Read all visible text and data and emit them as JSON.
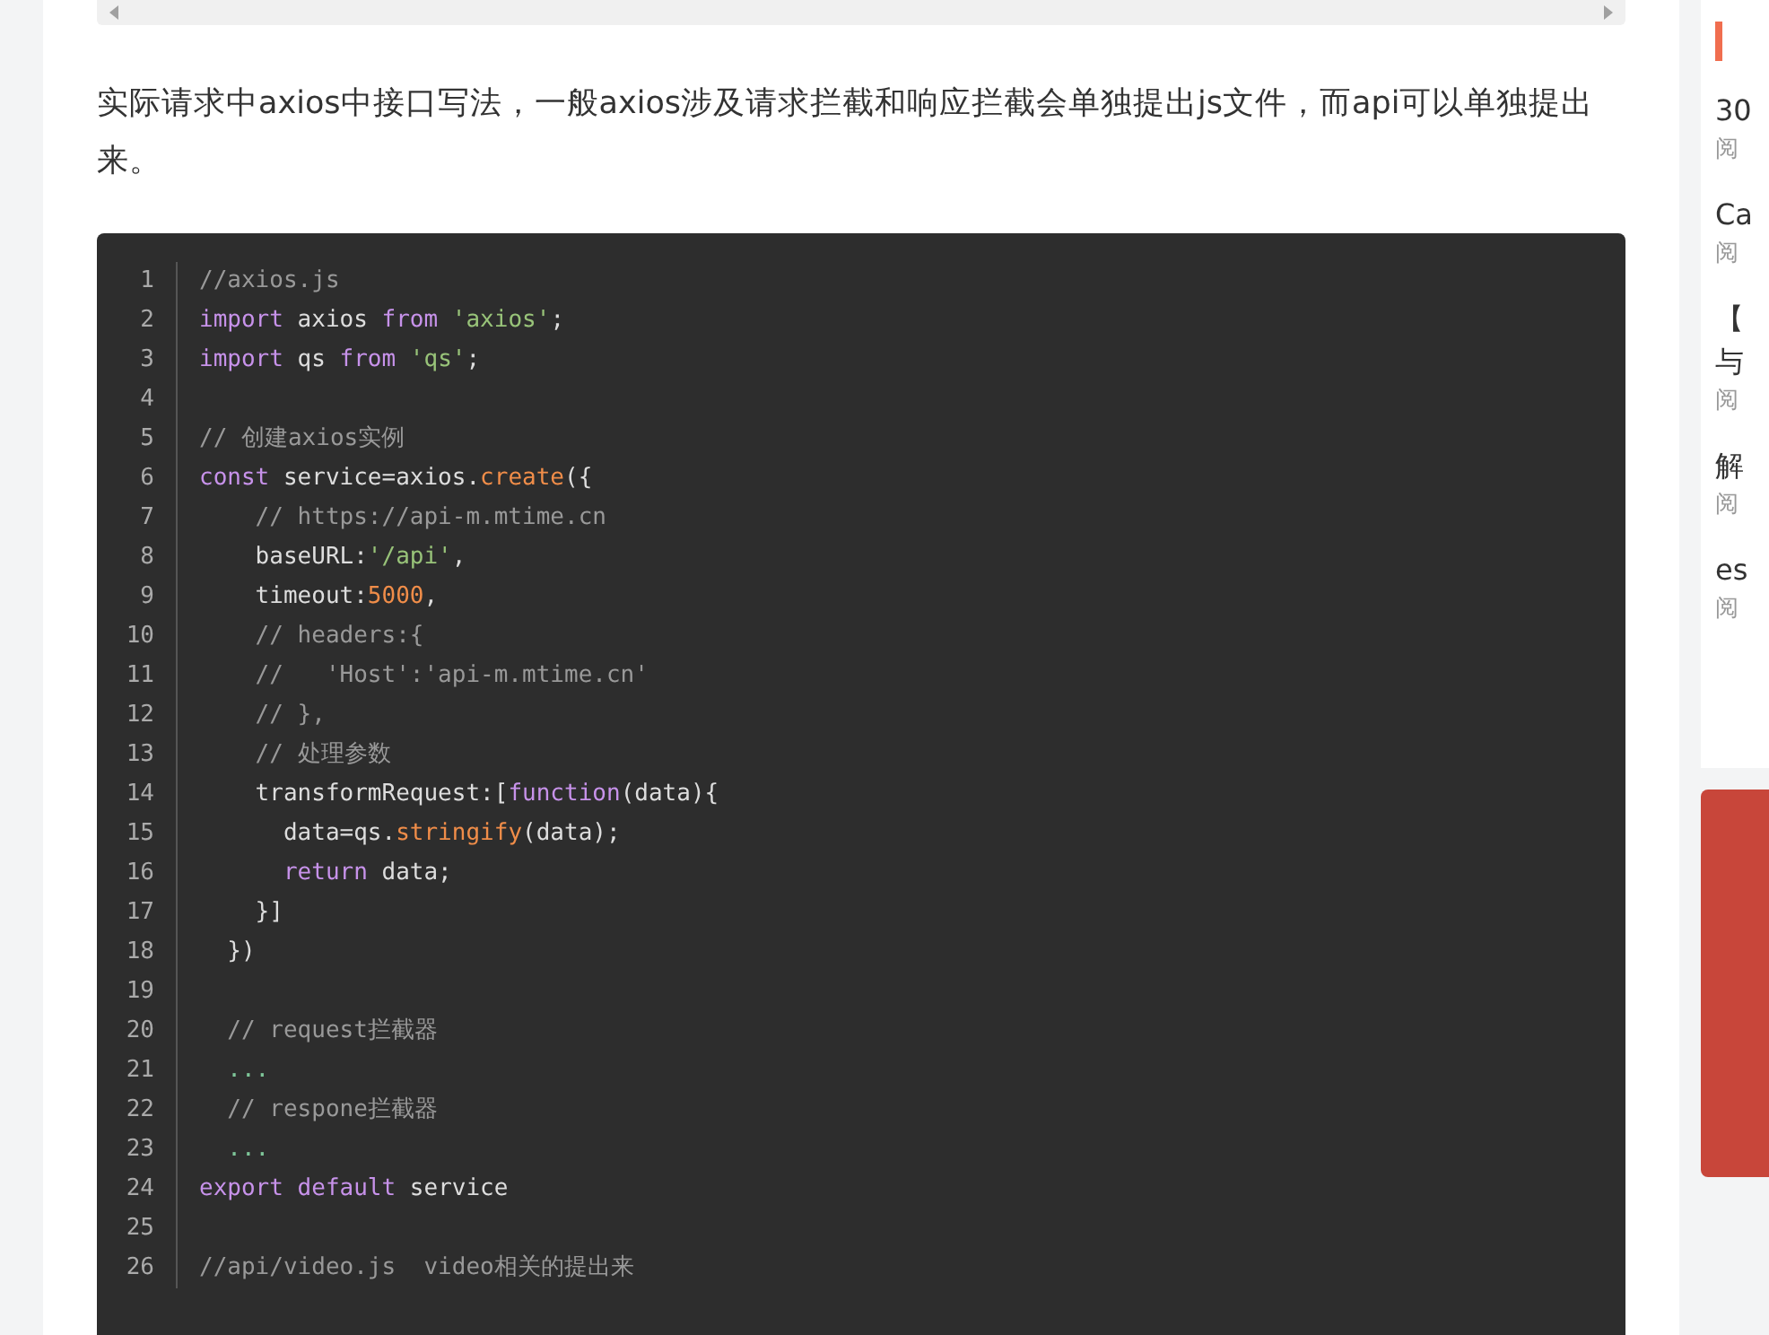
{
  "article": {
    "paragraph": "实际请求中axios中接口写法，一般axios涉及请求拦截和响应拦截会单独提出js文件，而api可以单独提出来。",
    "code_block": {
      "lines": [
        {
          "number": "1",
          "tokens": [
            {
              "kind": "comment",
              "text": "//axios.js"
            }
          ]
        },
        {
          "number": "2",
          "tokens": [
            {
              "kind": "keyword",
              "text": "import"
            },
            {
              "kind": "plain",
              "text": " axios "
            },
            {
              "kind": "keyword",
              "text": "from"
            },
            {
              "kind": "string",
              "text": " 'axios'"
            },
            {
              "kind": "plain",
              "text": ";"
            }
          ]
        },
        {
          "number": "3",
          "tokens": [
            {
              "kind": "keyword",
              "text": "import"
            },
            {
              "kind": "plain",
              "text": " qs "
            },
            {
              "kind": "keyword",
              "text": "from"
            },
            {
              "kind": "string",
              "text": " 'qs'"
            },
            {
              "kind": "plain",
              "text": ";"
            }
          ]
        },
        {
          "number": "4"
        },
        {
          "number": "5",
          "tokens": [
            {
              "kind": "comment",
              "text": "// 创建axios实例"
            }
          ]
        },
        {
          "number": "6",
          "tokens": [
            {
              "kind": "keyword",
              "text": "const"
            },
            {
              "kind": "plain",
              "text": " service=axios."
            },
            {
              "kind": "func",
              "text": "create"
            },
            {
              "kind": "plain",
              "text": "({"
            }
          ]
        },
        {
          "number": "7",
          "tokens": [
            {
              "kind": "comment",
              "text": "    // https://api-m.mtime.cn"
            }
          ]
        },
        {
          "number": "8",
          "tokens": [
            {
              "kind": "plain",
              "text": "    baseURL:"
            },
            {
              "kind": "string",
              "text": "'/api'"
            },
            {
              "kind": "plain",
              "text": ","
            }
          ]
        },
        {
          "number": "9",
          "tokens": [
            {
              "kind": "plain",
              "text": "    timeout:"
            },
            {
              "kind": "number",
              "text": "5000"
            },
            {
              "kind": "plain",
              "text": ","
            }
          ]
        },
        {
          "number": "10",
          "tokens": [
            {
              "kind": "comment",
              "text": "    // headers:{"
            }
          ]
        },
        {
          "number": "11",
          "tokens": [
            {
              "kind": "comment",
              "text": "    //   'Host':'api-m.mtime.cn'"
            }
          ]
        },
        {
          "number": "12",
          "tokens": [
            {
              "kind": "comment",
              "text": "    // },"
            }
          ]
        },
        {
          "number": "13",
          "tokens": [
            {
              "kind": "comment",
              "text": "    // 处理参数"
            }
          ]
        },
        {
          "number": "14",
          "tokens": [
            {
              "kind": "plain",
              "text": "    transformRequest:["
            },
            {
              "kind": "keyword",
              "text": "function"
            },
            {
              "kind": "plain",
              "text": "(data){"
            }
          ]
        },
        {
          "number": "15",
          "tokens": [
            {
              "kind": "plain",
              "text": "      data=qs."
            },
            {
              "kind": "func",
              "text": "stringify"
            },
            {
              "kind": "plain",
              "text": "(data);"
            }
          ]
        },
        {
          "number": "16",
          "tokens": [
            {
              "kind": "keyword",
              "text": "      return"
            },
            {
              "kind": "plain",
              "text": " data;"
            }
          ]
        },
        {
          "number": "17",
          "tokens": [
            {
              "kind": "plain",
              "text": "    }]"
            }
          ]
        },
        {
          "number": "18",
          "tokens": [
            {
              "kind": "plain",
              "text": "  })"
            }
          ]
        },
        {
          "number": "19"
        },
        {
          "number": "20",
          "tokens": [
            {
              "kind": "comment",
              "text": "  // request拦截器"
            }
          ]
        },
        {
          "number": "21",
          "tokens": [
            {
              "kind": "ellipsis",
              "text": "  ..."
            }
          ]
        },
        {
          "number": "22",
          "tokens": [
            {
              "kind": "comment",
              "text": "  // respone拦截器"
            }
          ]
        },
        {
          "number": "23",
          "tokens": [
            {
              "kind": "ellipsis",
              "text": "  ..."
            }
          ]
        },
        {
          "number": "24",
          "tokens": [
            {
              "kind": "keyword",
              "text": "export"
            },
            {
              "kind": "keyword",
              "text": " default"
            },
            {
              "kind": "plain",
              "text": " service"
            }
          ]
        },
        {
          "number": "25"
        },
        {
          "number": "26",
          "tokens": [
            {
              "kind": "comment",
              "text": "//api/video.js  video相关的提出来"
            }
          ]
        }
      ]
    }
  },
  "sidebar": {
    "items": [
      {
        "title_lines": [
          "30"
        ],
        "meta": "阅"
      },
      {
        "title_lines": [
          "Ca"
        ],
        "meta": "阅"
      },
      {
        "title_lines": [
          "【",
          "与"
        ],
        "meta": "阅"
      },
      {
        "title_lines": [
          "解"
        ],
        "meta": "阅"
      },
      {
        "title_lines": [
          "es"
        ],
        "meta": "阅"
      }
    ]
  }
}
